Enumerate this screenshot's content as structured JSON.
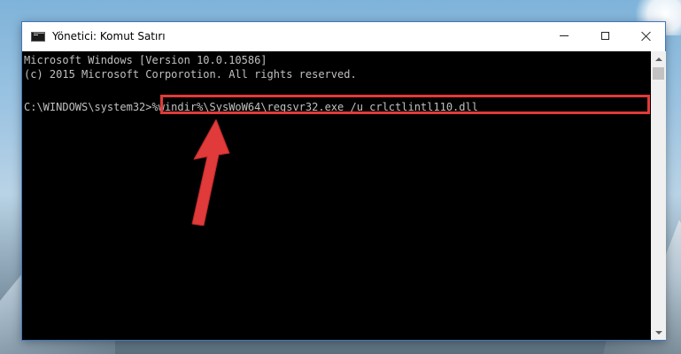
{
  "window": {
    "title": "Yönetici: Komut Satırı",
    "icon": "cmd-icon",
    "controls": [
      "minimize-icon",
      "maximize-icon",
      "close-icon"
    ]
  },
  "console": {
    "lines": [
      "Microsoft Windows [Version 10.0.10586]",
      "(c) 2015 Microsoft Corporotion. All rights reserved."
    ],
    "prompt": "C:\\WINDOWS\\system32>",
    "command": "%windir%\\SysWoW64\\regsvr32.exe /u crlctlintl110.dll",
    "text_color": "#c0c0c0",
    "background_color": "#000000"
  },
  "annotation": {
    "highlight_color": "#e03a3a",
    "arrow_color": "#e03a3a"
  }
}
